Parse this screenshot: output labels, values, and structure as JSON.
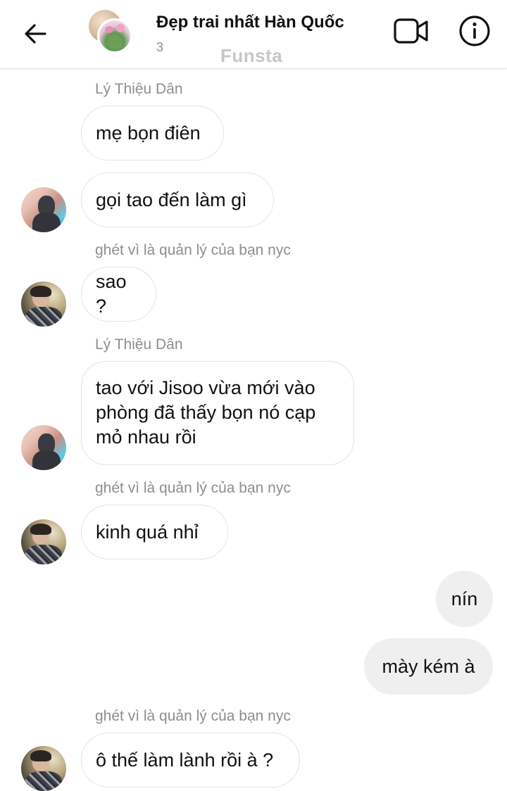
{
  "header": {
    "title": "Đẹp trai nhất Hàn Quốc",
    "member_count": "3",
    "watermark": "Funsta",
    "back_icon": "arrow-left-icon",
    "video_icon": "video-camera-icon",
    "info_icon": "info-circle-icon"
  },
  "messages": [
    {
      "sender": "Lý Thiệu Dân",
      "text": "mẹ bọn điên"
    },
    {
      "text": "gọi tao đến làm gì"
    },
    {
      "sender": "ghét vì là quản lý của bạn nyc",
      "text": "sao ?"
    },
    {
      "sender": "Lý Thiệu Dân",
      "text": "tao với Jisoo vừa mới vào phòng đã thấy bọn nó cạp mỏ nhau rồi"
    },
    {
      "sender": "ghét vì là quản lý của bạn nyc",
      "text": "kinh quá nhỉ"
    },
    {
      "text": "nín"
    },
    {
      "text": "mày kém à"
    },
    {
      "sender": "ghét vì là quản lý của bạn nyc",
      "text": "ô thế làm lành rồi à ?"
    }
  ],
  "colors": {
    "bubble_border": "#e3e3e3",
    "my_bubble_bg": "#efefef",
    "meta_text": "#8e8e8e"
  }
}
